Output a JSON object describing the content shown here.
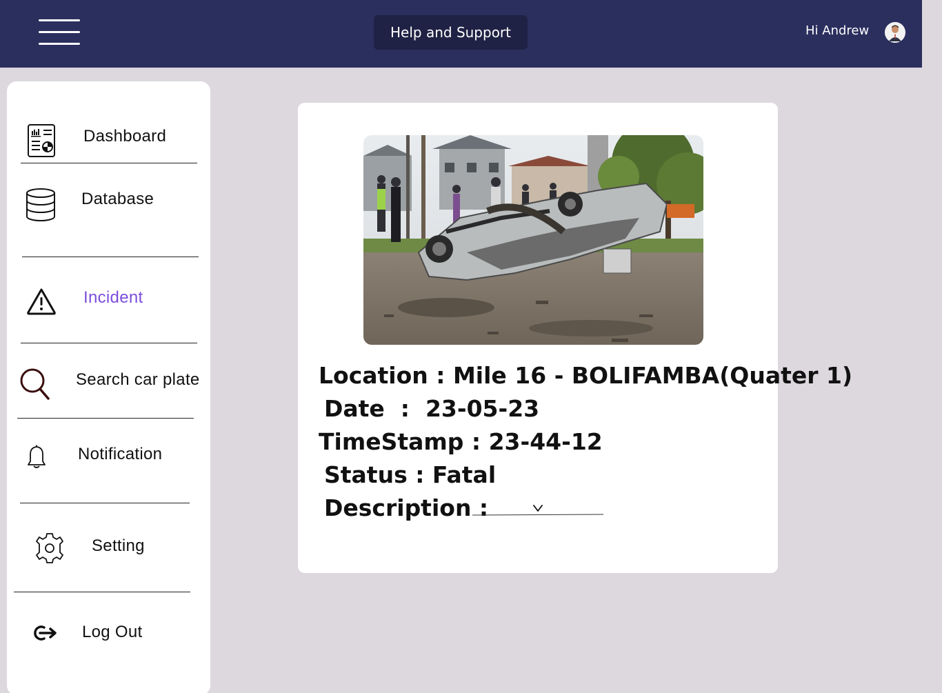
{
  "header": {
    "help_label": "Help and Support",
    "greeting": "Hi Andrew"
  },
  "sidebar": {
    "items": [
      {
        "label": "Dashboard",
        "icon": "dashboard-report-icon",
        "active": false
      },
      {
        "label": "Database",
        "icon": "database-icon",
        "active": false
      },
      {
        "label": "Incident",
        "icon": "warning-triangle-icon",
        "active": true
      },
      {
        "label": "Search car plate",
        "icon": "search-icon",
        "active": false
      },
      {
        "label": "Notification",
        "icon": "bell-icon",
        "active": false
      },
      {
        "label": "Setting",
        "icon": "gear-icon",
        "active": false
      },
      {
        "label": "Log Out",
        "icon": "logout-icon",
        "active": false
      }
    ],
    "active_color": "#7c4ddb"
  },
  "incident": {
    "location": "Location : Mile 16 - BOLIFAMBA(Quater 1)",
    "date": "Date  :  23-05-23",
    "timestamp": "TimeStamp : 23-44-12",
    "status": "Status : Fatal",
    "description_label": "Description :",
    "description_value": ""
  },
  "colors": {
    "topbar": "#2b2f5e",
    "help_button": "#1f2244",
    "background": "#dcd8dd"
  }
}
